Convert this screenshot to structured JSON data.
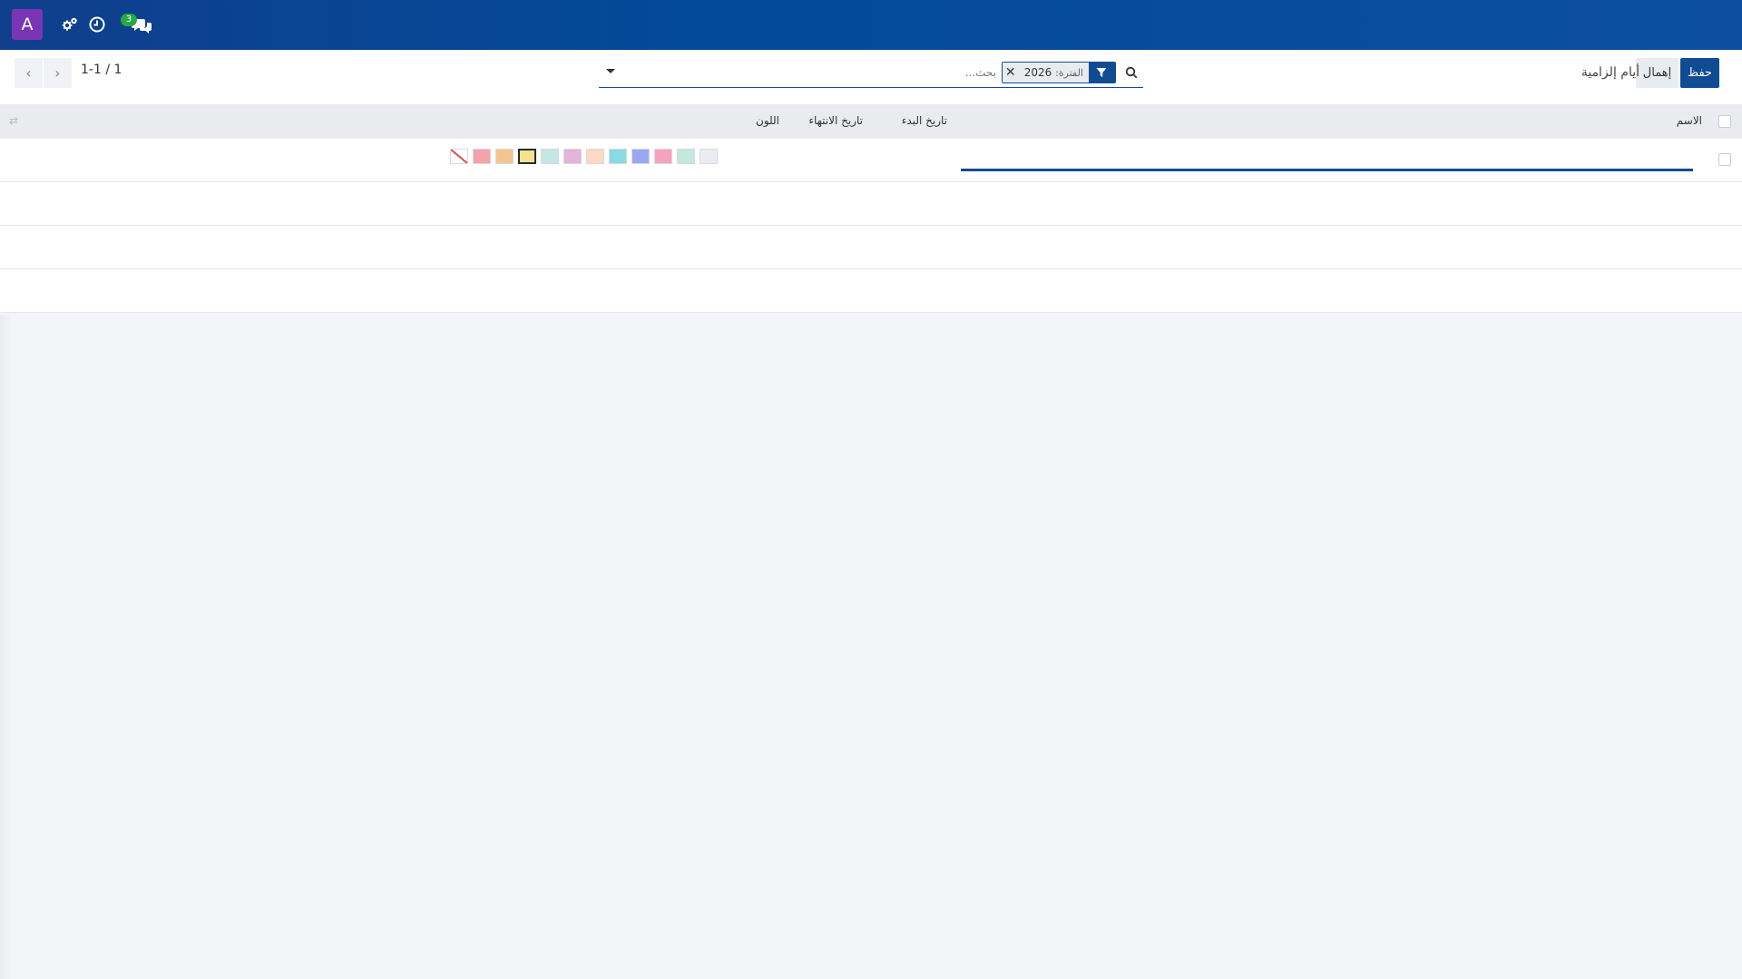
{
  "navbar": {
    "avatar_letter": "A",
    "icons": [
      "settings-icon",
      "activity-clock-icon",
      "discuss-icon"
    ],
    "message_count": "3"
  },
  "control": {
    "save_label": "حفظ",
    "discard_label": "إهمال",
    "page_title": "أيام إلزامية",
    "search": {
      "facet_label": "الفترة:",
      "facet_value": "2026",
      "placeholder": "بحث..."
    },
    "pager": "1-1 / 1"
  },
  "list": {
    "columns": {
      "name": "الاسم",
      "start_date": "تاريخ البدء",
      "end_date": "تاريخ الانتهاء",
      "color": "اللون"
    },
    "colors": [
      "#e9ecf3",
      "#c5e8dc",
      "#f5a3bc",
      "#9aa8f2",
      "#88dbe2",
      "#fbd9c3",
      "#e3b3d9",
      "#c4e6e6",
      "#fbe08c",
      "#f4c48d",
      "#f4a3aa"
    ],
    "selected_color_index": 8
  }
}
